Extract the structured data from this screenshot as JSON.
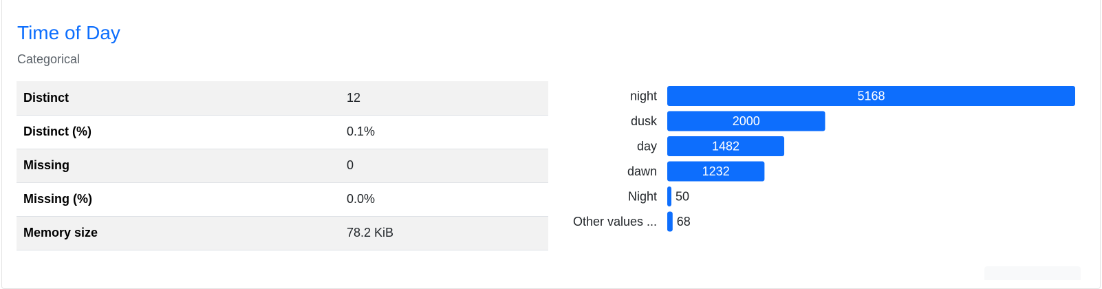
{
  "variable": {
    "title": "Time of Day",
    "type": "Categorical"
  },
  "stats": [
    {
      "label": "Distinct",
      "value": "12"
    },
    {
      "label": "Distinct (%)",
      "value": "0.1%"
    },
    {
      "label": "Missing",
      "value": "0"
    },
    {
      "label": "Missing (%)",
      "value": "0.0%"
    },
    {
      "label": "Memory size",
      "value": "78.2 KiB"
    }
  ],
  "chart_data": {
    "type": "bar",
    "orientation": "horizontal",
    "categories": [
      "night",
      "dusk",
      "day",
      "dawn",
      "Night",
      "Other values ..."
    ],
    "values": [
      5168,
      2000,
      1482,
      1232,
      50,
      68
    ],
    "color": "#0d6efd",
    "title": "",
    "xlabel": "",
    "ylabel": "",
    "xlim": [
      0,
      5168
    ],
    "grid": false
  },
  "colors": {
    "accent": "#0d6efd",
    "row_alt": "#f2f2f2"
  }
}
